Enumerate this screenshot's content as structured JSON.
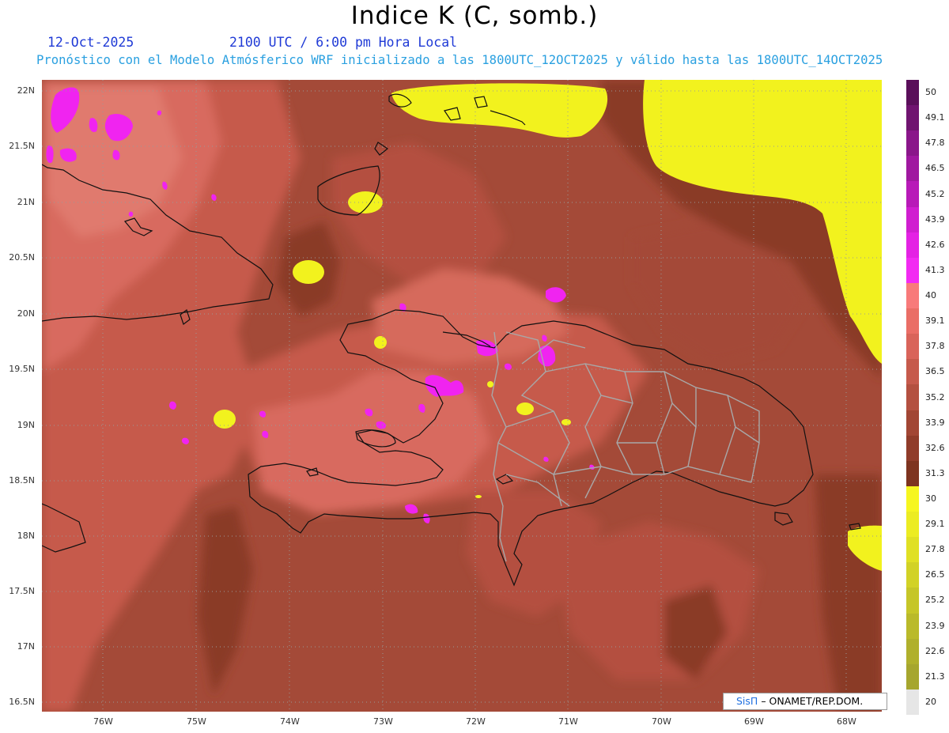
{
  "title": "Indice K (C, somb.)",
  "date": "12-Oct-2025",
  "valid_time": "2100 UTC / 6:00 pm Hora Local",
  "forecast_note": "Pronóstico con el Modelo Atmósferico WRF inicializado a las 1800UTC_12OCT2025 y válido hasta las  1800UTC_14OCT2025",
  "lat_labels": [
    "22N",
    "21.5N",
    "21N",
    "20.5N",
    "20N",
    "19.5N",
    "19N",
    "18.5N",
    "18N",
    "17.5N",
    "17N",
    "16.5N"
  ],
  "lon_labels": [
    "76W",
    "75W",
    "74W",
    "73W",
    "72W",
    "71W",
    "70W",
    "69W",
    "68W"
  ],
  "colorbar": {
    "labels": [
      "50",
      "49.1",
      "47.8",
      "46.5",
      "45.2",
      "43.9",
      "42.6",
      "41.3",
      "40",
      "39.1",
      "37.8",
      "36.5",
      "35.2",
      "33.9",
      "32.6",
      "31.3",
      "30",
      "29.1",
      "27.8",
      "26.5",
      "25.2",
      "23.9",
      "22.6",
      "21.3",
      "20"
    ],
    "colors": [
      "#5a0f5a",
      "#701470",
      "#8a168a",
      "#a018a0",
      "#b81ab8",
      "#d01ed0",
      "#e422e4",
      "#f22af2",
      "#f87a7a",
      "#ea6e66",
      "#d9645a",
      "#c65a4c",
      "#b45040",
      "#a24634",
      "#903c2a",
      "#7e3420",
      "#f6f620",
      "#ecec22",
      "#e0e024",
      "#d2d226",
      "#c6c628",
      "#baba2a",
      "#b0b02c",
      "#a6a62e",
      "#e6e6e6"
    ]
  },
  "credit": {
    "brand": "SisΠ",
    "text": "– ONAMET/REP.DOM."
  },
  "colors": {
    "accent": "#1f3ad6",
    "subtitle": "#2aa0e0",
    "background_field": "#a44a38"
  }
}
